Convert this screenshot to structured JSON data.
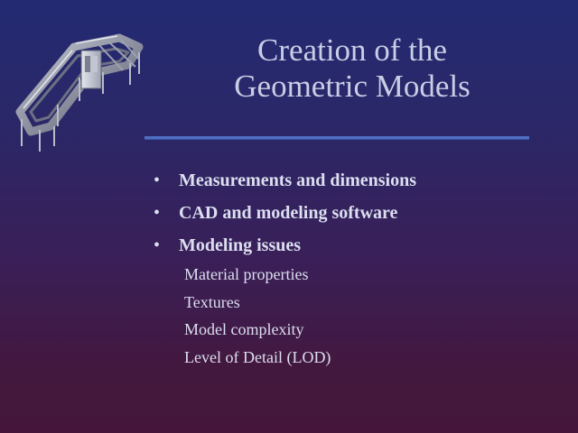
{
  "slide": {
    "title_lines": [
      "Creation of the",
      "Geometric Models"
    ],
    "bullets": [
      {
        "marker": "•",
        "text": "Measurements and dimensions"
      },
      {
        "marker": "•",
        "text": "CAD and modeling software"
      },
      {
        "marker": "•",
        "text": "Modeling issues"
      }
    ],
    "subitems": [
      "Material properties",
      "Textures",
      "Model complexity",
      "Level of Detail (LOD)"
    ]
  },
  "colors": {
    "background_top": "#232a72",
    "background_bottom": "#45163a",
    "title_text": "#c9cde6",
    "body_text": "#dcdff0",
    "rule": "#4f6fc3"
  }
}
